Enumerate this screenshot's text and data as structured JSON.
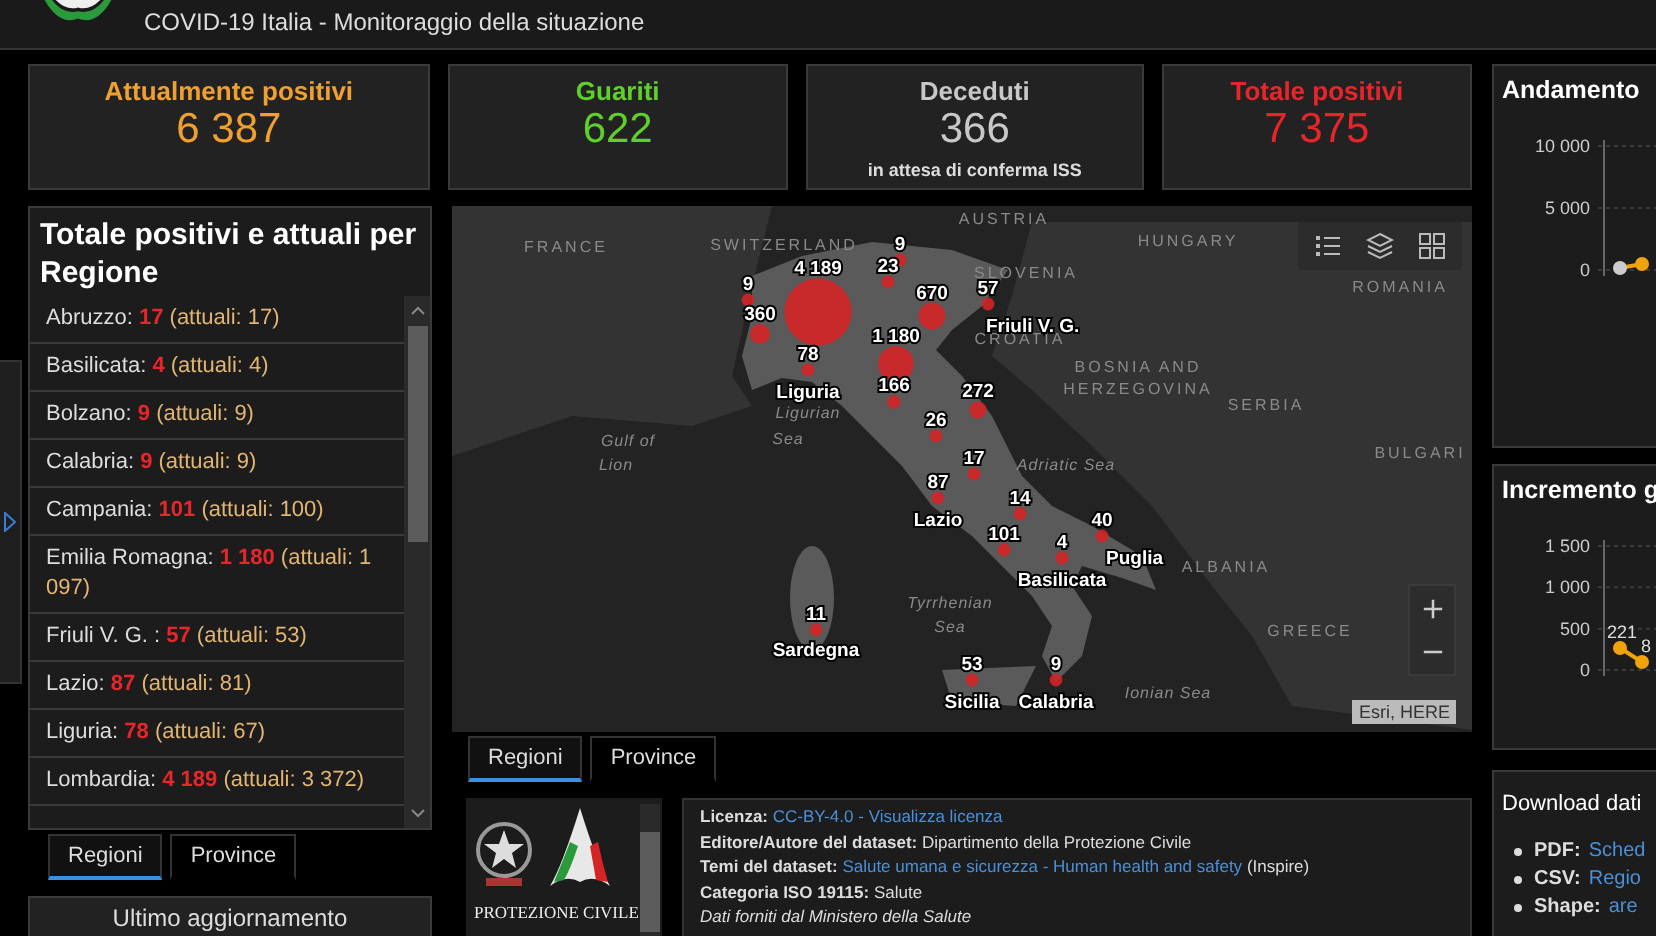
{
  "header": {
    "title": "COVID-19 Italia - Monitoraggio della situazione"
  },
  "stats": [
    {
      "label": "Attualmente positivi",
      "value": "6 387",
      "color": "#f0a030"
    },
    {
      "label": "Guariti",
      "value": "622",
      "color": "#5fcf2a"
    },
    {
      "label": "Deceduti",
      "value": "366",
      "color": "#c8c8c8",
      "note": "in attesa di conferma ISS"
    },
    {
      "label": "Totale positivi",
      "value": "7 375",
      "color": "#e8262a"
    }
  ],
  "regions_panel": {
    "title": "Totale positivi e attuali per Regione",
    "items": [
      {
        "name": "Abruzzo:",
        "total": "17",
        "current": "(attuali: 17)"
      },
      {
        "name": "Basilicata:",
        "total": "4",
        "current": "(attuali: 4)"
      },
      {
        "name": "Bolzano:",
        "total": "9",
        "current": "(attuali: 9)"
      },
      {
        "name": "Calabria:",
        "total": "9",
        "current": "(attuali: 9)"
      },
      {
        "name": "Campania:",
        "total": "101",
        "current": "(attuali: 100)"
      },
      {
        "name": "Emilia Romagna:",
        "total": "1 180",
        "current": "(attuali: 1 097)"
      },
      {
        "name": "Friuli V. G. :",
        "total": "57",
        "current": "(attuali: 53)"
      },
      {
        "name": "Lazio:",
        "total": "87",
        "current": "(attuali: 81)"
      },
      {
        "name": "Liguria:",
        "total": "78",
        "current": "(attuali: 67)"
      },
      {
        "name": "Lombardia:",
        "total": "4 189",
        "current": "(attuali: 3 372)"
      }
    ],
    "tabs": [
      {
        "label": "Regioni",
        "selected": true
      },
      {
        "label": "Province",
        "selected": false
      }
    ],
    "update_box": {
      "title": "Ultimo aggiornamento"
    }
  },
  "map": {
    "places": [
      "FRANCE",
      "SWITZERLAND",
      "AUSTRIA",
      "HUNGARY",
      "SLOVENIA",
      "ROMANIA",
      "CROATIA",
      "BOSNIA AND",
      "HERZEGOVINA",
      "SERBIA",
      "BULGARI",
      "Gulf of",
      "Lion",
      "Ligurian",
      "Sea",
      "Adriatic Sea",
      "ALBANIA",
      "Tyrrhenian",
      "Sea",
      "GREECE",
      "Ionian Sea"
    ],
    "markers": [
      {
        "value": "9"
      },
      {
        "value": "360"
      },
      {
        "value": "4 189"
      },
      {
        "value": "9"
      },
      {
        "value": "23"
      },
      {
        "value": "670"
      },
      {
        "value": "57",
        "name": "Friuli V. G."
      },
      {
        "value": "1 180"
      },
      {
        "value": "78",
        "name": "Liguria"
      },
      {
        "value": "166"
      },
      {
        "value": "272"
      },
      {
        "value": "26"
      },
      {
        "value": "17"
      },
      {
        "value": "87",
        "name": "Lazio"
      },
      {
        "value": "14"
      },
      {
        "value": "101"
      },
      {
        "value": "4",
        "name": "Basilicata"
      },
      {
        "value": "40",
        "name": "Puglia"
      },
      {
        "value": "11",
        "name": "Sardegna"
      },
      {
        "value": "53",
        "name": "Sicilia"
      },
      {
        "value": "9",
        "name": "Calabria"
      }
    ],
    "attribution": "Esri, HERE",
    "tabs": [
      {
        "label": "Regioni",
        "selected": true
      },
      {
        "label": "Province",
        "selected": false
      }
    ]
  },
  "logo_panel": {
    "caption": "PROTEZIONE CIVILE"
  },
  "info": {
    "lines": [
      [
        {
          "kind": "label",
          "text": "Licenza:"
        },
        {
          "kind": "link",
          "text": "CC-BY-4.0"
        },
        {
          "kind": "link",
          "text": "-"
        },
        {
          "kind": "link",
          "text": "Visualizza licenza"
        }
      ],
      [
        {
          "kind": "label",
          "text": "Editore/Autore del dataset:"
        },
        {
          "kind": "text",
          "text": "Dipartimento della Protezione Civile"
        }
      ],
      [
        {
          "kind": "label",
          "text": "Temi del dataset:"
        },
        {
          "kind": "link",
          "text": "Salute umana e sicurezza - Human health and safety"
        },
        {
          "kind": "text",
          "text": "(Inspire)"
        }
      ],
      [
        {
          "kind": "label",
          "text": "Categoria ISO 19115:"
        },
        {
          "kind": "text",
          "text": "Salute"
        }
      ],
      [
        {
          "kind": "italic",
          "text": "Dati forniti dal Ministero della Salute"
        }
      ]
    ]
  },
  "charts": [
    {
      "title": "Andamento",
      "axis_labels": [
        "10 000",
        "5 000",
        "0"
      ]
    },
    {
      "title": "Incremento g",
      "axis_labels": [
        "1 500",
        "1 000",
        "500",
        "0"
      ],
      "point_labels": [
        "221",
        "8"
      ]
    }
  ],
  "downloads": {
    "title": "Download dati",
    "items": [
      {
        "label": "PDF:",
        "link": "Sched"
      },
      {
        "label": "CSV:",
        "link": "Regio"
      },
      {
        "label": "Shape:",
        "link": "are"
      }
    ]
  }
}
